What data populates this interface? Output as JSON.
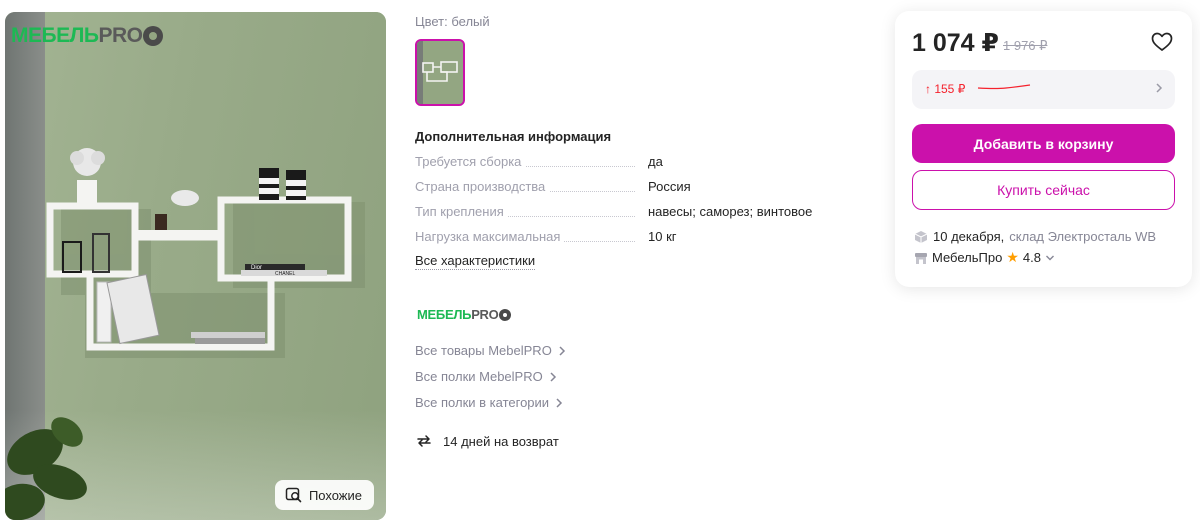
{
  "photo": {
    "brand_logo_green": "МЕБЕЛЬ",
    "brand_logo_dark": "PRO",
    "similar_button_label": "Похожие",
    "similar_icon": "search-image-icon",
    "book_label": "CHANEL",
    "box_label": "Dior"
  },
  "color": {
    "label": "Цвет:",
    "value": "белый"
  },
  "additional_info": {
    "title": "Дополнительная информация",
    "rows": [
      {
        "key": "Требуется сборка",
        "value": "да"
      },
      {
        "key": "Страна производства",
        "value": "Россия"
      },
      {
        "key": "Тип крепления",
        "value": "навесы; саморез; винтовое"
      },
      {
        "key": "Нагрузка максимальная",
        "value": "10 кг"
      }
    ],
    "all_specs_link": "Все характеристики"
  },
  "seller_block": {
    "logo_green": "МЕБЕЛЬ",
    "logo_dark": "PRO",
    "links": [
      "Все товары MebelPRO",
      "Все полки MebelPRO",
      "Все полки в категории"
    ],
    "return_text": "14 дней на возврат",
    "return_icon": "return-arrows-icon"
  },
  "price_card": {
    "price": "1 074 ₽",
    "old_price": "1 976 ₽",
    "wallet_delta": "↑ 155 ₽",
    "add_to_cart": "Добавить в корзину",
    "buy_now": "Купить сейчас",
    "delivery_date": "10 декабря,",
    "warehouse": "склад Электросталь WB",
    "seller_name": "МебельПро",
    "rating": "4.8",
    "accent_color": "#cb11ab",
    "discount_color": "#f5222d",
    "star_color": "#ff9e00"
  }
}
